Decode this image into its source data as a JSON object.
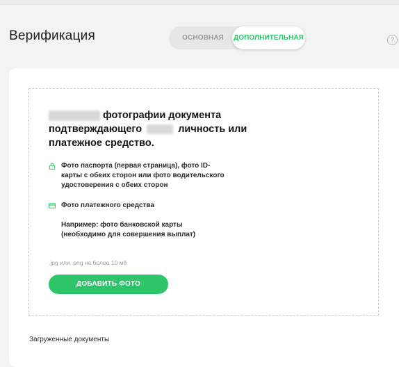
{
  "header": {
    "title": "Верификация",
    "tabs": [
      {
        "label": "Основная",
        "active": false
      },
      {
        "label": "Дополнительная",
        "active": true
      }
    ],
    "help_symbol": "?"
  },
  "upload": {
    "heading_line1_text": "фотографии документа",
    "heading_line2_text_a": "подтверждающего",
    "heading_line2_text_b": "личность или",
    "heading_line3_text": "платежное средство.",
    "requirements": [
      {
        "icon": "lock-icon",
        "text": "Фото паспорта (первая страница), фото ID-карты с обеих сторон или фото водительского удостоверения с обеих сторон"
      },
      {
        "icon": "credit-card-icon",
        "text": "Фото платежного средства"
      }
    ],
    "example_text": "Например: фото банковской карты (необходимо для совершения выплат)",
    "file_hint": ".jpg или .png не более 10 мб",
    "button_label": "Добавить фото"
  },
  "uploaded_documents_label": "Загруженные документы",
  "colors": {
    "accent": "#2ec46a",
    "background": "#f3f3f3",
    "card": "#ffffff"
  }
}
